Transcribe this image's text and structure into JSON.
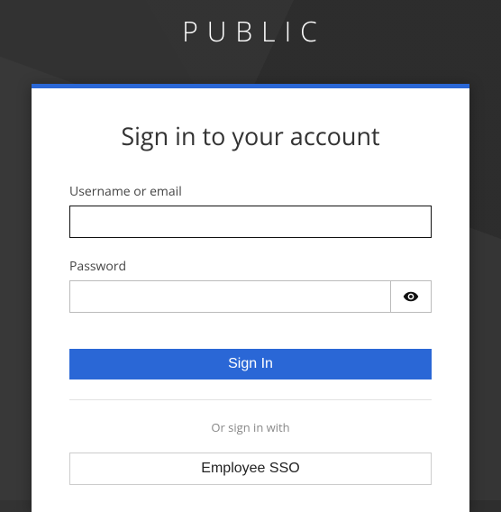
{
  "brand": "PUBLIC",
  "card": {
    "title": "Sign in to your account",
    "username_label": "Username or email",
    "username_value": "",
    "password_label": "Password",
    "password_value": "",
    "signin_label": "Sign In",
    "divider_text": "Or sign in with",
    "sso_label": "Employee SSO"
  },
  "colors": {
    "accent": "#2a67d6",
    "text": "#333333",
    "muted": "#888888",
    "border": "#bbbbbb"
  }
}
